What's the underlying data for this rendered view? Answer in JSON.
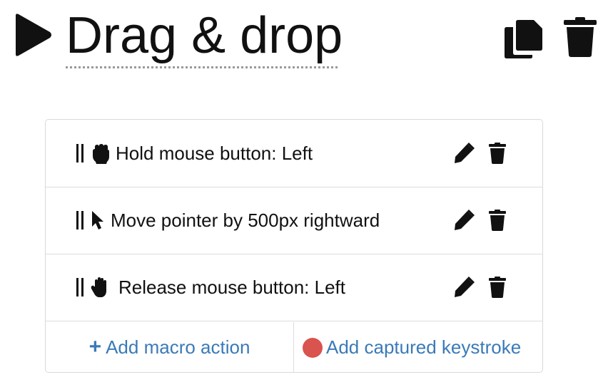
{
  "header": {
    "title": "Drag & drop",
    "icons": {
      "play": "play-icon",
      "copy": "copy-icon",
      "delete": "trash-icon"
    }
  },
  "actions": [
    {
      "label": "Hold mouse button: Left",
      "icon": "hand-grab-icon"
    },
    {
      "label": "Move pointer by 500px rightward",
      "icon": "mouse-pointer-icon"
    },
    {
      "label": "Release mouse button: Left",
      "icon": "hand-open-icon"
    }
  ],
  "footer": {
    "add_action_plus": "+",
    "add_action_label": "Add macro action",
    "add_capture_label": "Add captured keystroke"
  },
  "colors": {
    "link": "#3a7ab8",
    "record": "#d9534f",
    "text": "#111111"
  }
}
